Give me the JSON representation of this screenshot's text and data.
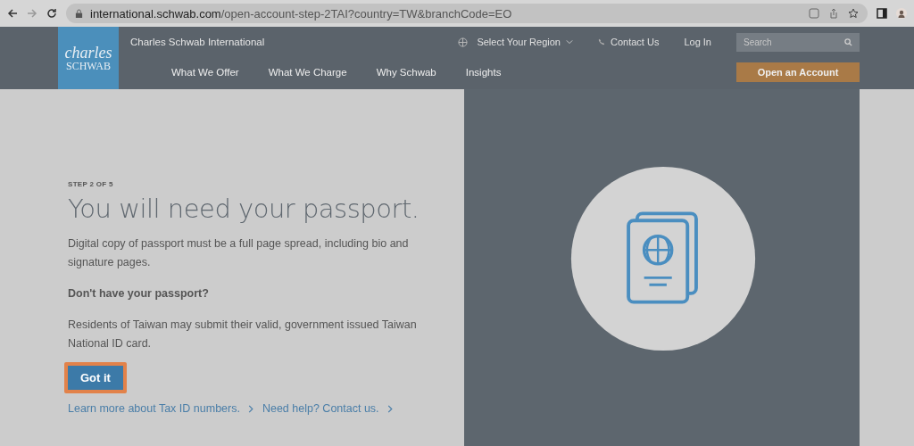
{
  "browser": {
    "url_host": "international.schwab.com",
    "url_path": "/open-account-step-2TAI?country=TW&branchCode=EO"
  },
  "header": {
    "logo_top": "charles",
    "logo_bottom": "SCHWAB",
    "site_name": "Charles Schwab International",
    "region": "Select Your Region",
    "contact": "Contact Us",
    "login": "Log In",
    "search": {
      "placeholder": "Search"
    },
    "nav": [
      "What We Offer",
      "What We Charge",
      "Why Schwab",
      "Insights"
    ],
    "cta": "Open an Account"
  },
  "step": "STEP 2 OF 5",
  "title": "You will need your passport.",
  "intro": "Digital copy of passport must be a full page spread, including bio and signature pages.",
  "subheading": "Don't have your passport?",
  "note": "Residents of Taiwan may submit their valid, government issued Taiwan National ID card.",
  "button": {
    "label": "Got it",
    "highlighted": true
  },
  "links": [
    "Learn more about Tax ID numbers.",
    "Need help? Contact us."
  ]
}
